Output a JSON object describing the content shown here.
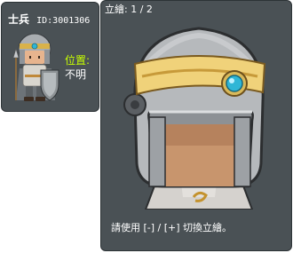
{
  "npc": {
    "name": "士兵",
    "id_text": "ID:3001306",
    "location_label": "位置:",
    "location_value": "不明"
  },
  "portrait_view": {
    "page_label": "立繪: 1 / 2",
    "hint": "請使用 [-] / [+] 切換立繪。"
  },
  "colors": {
    "panel_bg": "#4a5155",
    "location_label": "#c8ff00",
    "text": "#ffffff"
  },
  "icons": {
    "mini_sprite": "soldier-sprite-icon",
    "portrait": "soldier-portrait-icon"
  }
}
